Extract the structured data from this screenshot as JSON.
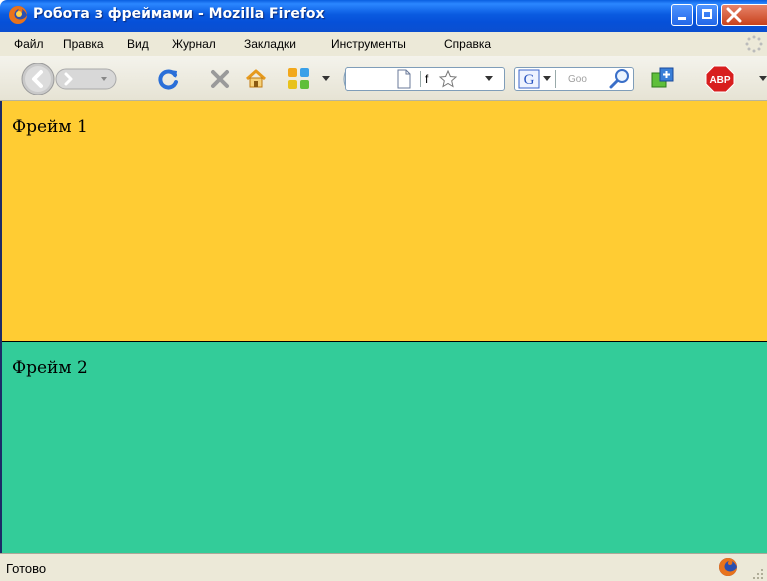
{
  "window": {
    "title": "Робота з фреймами - Mozilla Firefox",
    "controls": {
      "minimize": "minimize",
      "maximize": "maximize",
      "close": "close"
    }
  },
  "menu": {
    "items": [
      {
        "label": "Файл"
      },
      {
        "label": "Правка"
      },
      {
        "label": "Вид"
      },
      {
        "label": "Журнал"
      },
      {
        "label": "Закладки"
      },
      {
        "label": "Инструменты"
      },
      {
        "label": "Справка"
      }
    ]
  },
  "toolbar": {
    "icons": [
      "back-icon",
      "forward-icon",
      "dropdown-icon",
      "reload-icon",
      "stop-icon",
      "home-icon",
      "speed-dial-icon",
      "page-icon",
      "bookmark-star-icon",
      "google-icon",
      "search-icon",
      "addon-icon",
      "adblock-icon"
    ],
    "url_fragment": "f",
    "search_placeholder": "Goo",
    "adblock_label": "ABP"
  },
  "frames": [
    {
      "label": "Фрейм 1",
      "color": "#ffcc33"
    },
    {
      "label": "Фрейм 2",
      "color": "#33cc99"
    }
  ],
  "status": {
    "text": "Готово"
  },
  "colors": {
    "titlebar": "#0a5be0",
    "chrome": "#ece9d8"
  }
}
